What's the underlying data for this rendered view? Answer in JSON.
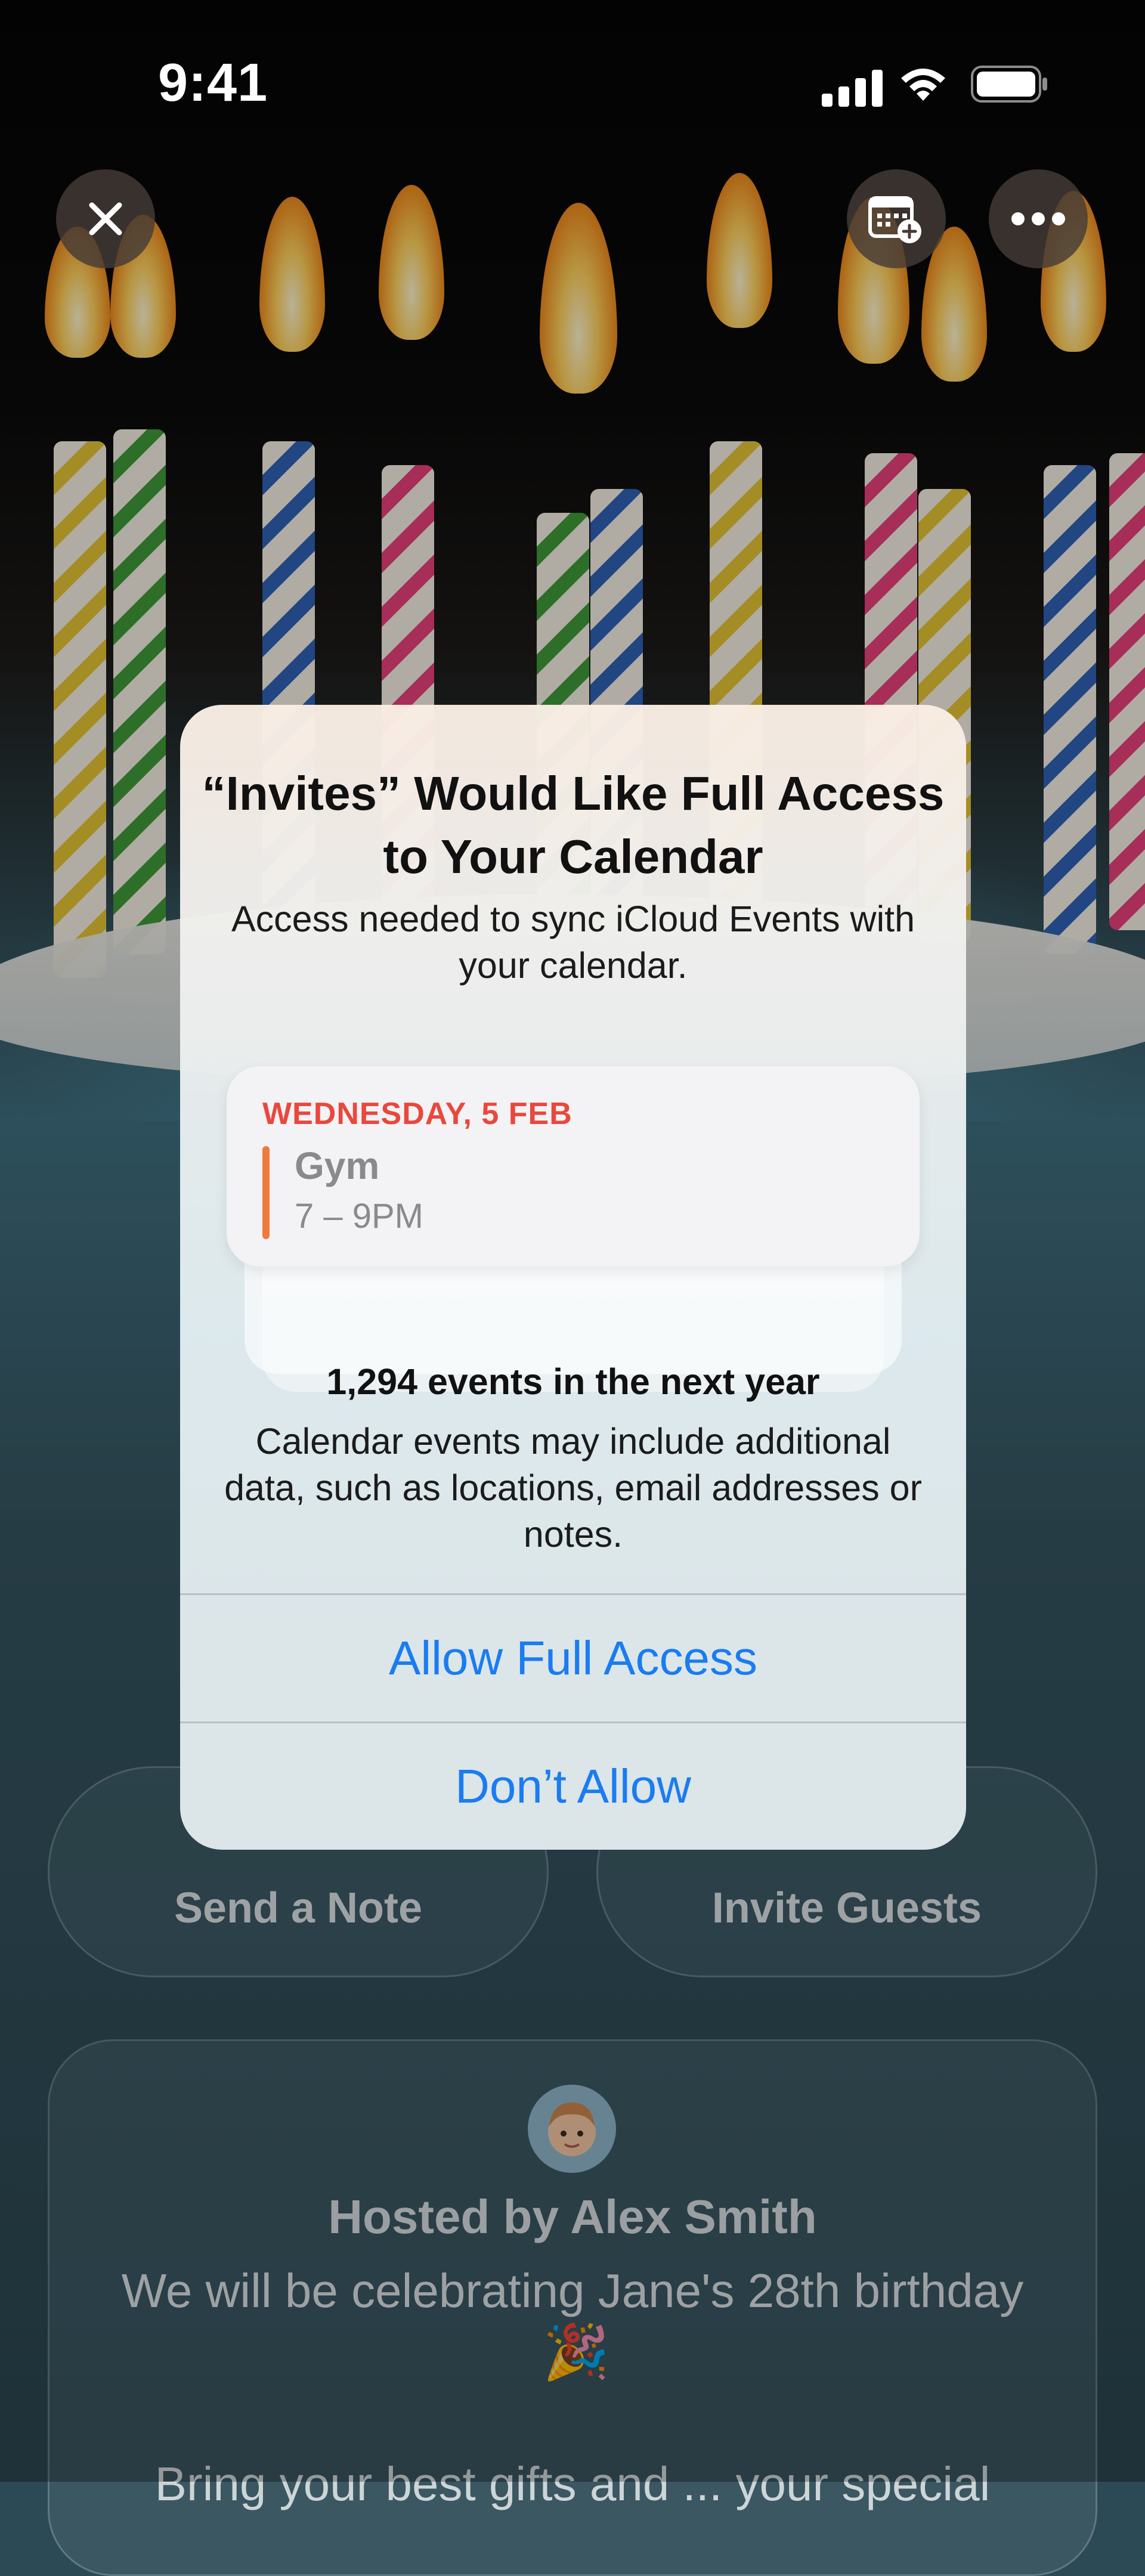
{
  "status_bar": {
    "time": "9:41"
  },
  "header": {
    "close_icon": "close-icon",
    "calendar_icon": "calendar-add-icon",
    "more_icon": "more-icon"
  },
  "alert": {
    "title": "“Invites” Would Like Full Access to Your Calendar",
    "message": "Access needed to sync iCloud Events with your calendar.",
    "calendar_preview": {
      "date": "WEDNESDAY, 5 FEB",
      "event": "Gym",
      "time": "7 – 9PM"
    },
    "count": "1,294 events in the next year",
    "note": "Calendar events may include additional data, such as locations, email addresses or notes.",
    "allow_label": "Allow Full Access",
    "deny_label": "Don’t Allow"
  },
  "actions": {
    "send_note": "Send a Note",
    "invite_guests": "Invite Guests"
  },
  "host": {
    "title": "Hosted by Alex Smith",
    "description": "We will be celebrating Jane's 28th birthday",
    "emoji": "🎉",
    "more": "Bring your best gifts and ... your special"
  },
  "colors": {
    "accent": "#1a7cf2",
    "date_red": "#e8483d",
    "event_bar": "#ef7a3c"
  }
}
